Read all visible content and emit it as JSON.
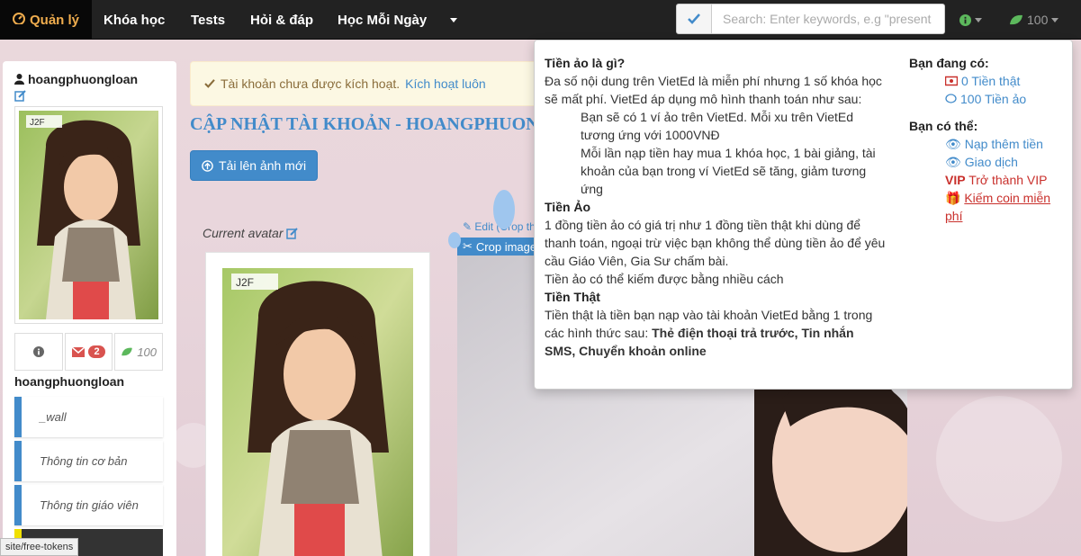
{
  "navbar": {
    "brand": "Quản lý",
    "items": [
      "Khóa học",
      "Tests",
      "Hỏi & đáp",
      "Học Mỗi Ngày"
    ],
    "search_placeholder": "Search: Enter keywords, e.g \"present",
    "coins": "100"
  },
  "sidebar": {
    "username": "hoangphuongloan",
    "stat_messages": "2",
    "stat_coins": "100",
    "username_repeat": "hoangphuongloan",
    "menu": [
      "_wall",
      "Thông tin cơ bản",
      "Thông tin giáo viên"
    ]
  },
  "main": {
    "alert_text": "Tài khoản chưa được kích hoạt.",
    "alert_link": "Kích hoạt luôn",
    "heading": "CẬP NHẬT TÀI KHOẢN - HOANGPHUON",
    "upload_button": "Tải lên ảnh mới",
    "current_avatar_label": "Current avatar",
    "edit_crop": "Edit (Crop th",
    "crop_image_label": "Crop image",
    "avatar_watermark": "J2F",
    "status_url": "site/free-tokens"
  },
  "popover": {
    "q1_title": "Tiền ảo là gì?",
    "q1_text": "Đa số nội dung trên VietEd là miễn phí nhưng 1 số khóa học sẽ mất phí. VietEd áp dụng mô hình thanh toán như sau:",
    "q1_point1": "Bạn sẽ có 1 ví ảo trên VietEd. Mỗi xu trên VietEd tương ứng với 1000VNĐ",
    "q1_point2": "Mỗi lần nạp tiền hay mua 1 khóa học, 1 bài giảng, tài khoản của bạn trong ví VietEd sẽ tăng, giảm tương ứng",
    "q2_title": "Tiền Ảo",
    "q2_text": "1 đồng tiền ảo có giá trị như 1 đồng tiền thật khi dùng để thanh toán, ngoại trừ việc bạn không thể dùng tiền ảo để yêu cầu Giáo Viên, Gia Sư chấm bài.",
    "q2_text2": "Tiền ảo có thể kiếm được bằng nhiều cách",
    "q3_title": "Tiền Thật",
    "q3_text": "Tiền thật là tiền bạn nạp vào tài khoản VietEd bằng 1 trong các hình thức sau:",
    "q3_bold": "Thẻ điện thoại trả trước, Tin nhắn SMS, Chuyển khoản online",
    "have_title": "Bạn đang có:",
    "real_money": "0 Tiền thật",
    "virtual_money": "100 Tiền ảo",
    "can_title": "Bạn có thể:",
    "topup": "Nạp thêm tiền",
    "transactions": "Giao dịch",
    "vip_badge": "VIP",
    "vip_text": "Trở thành VIP",
    "earn_coin": "Kiếm coin miễn phí"
  }
}
